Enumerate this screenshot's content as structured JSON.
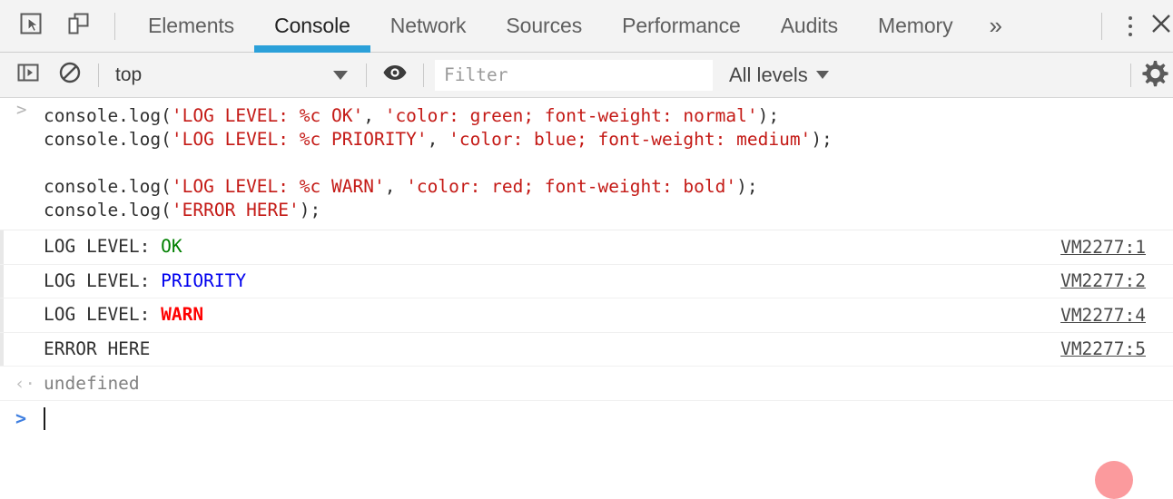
{
  "window": {
    "title": "DevTools - Console"
  },
  "tabbar": {
    "inspect_icon": "inspect-element-cursor-icon",
    "device_icon": "toggle-device-toolbar-icon",
    "tabs": [
      {
        "id": "elements",
        "label": "Elements",
        "active": false
      },
      {
        "id": "console",
        "label": "Console",
        "active": true
      },
      {
        "id": "network",
        "label": "Network",
        "active": false
      },
      {
        "id": "sources",
        "label": "Sources",
        "active": false
      },
      {
        "id": "performance",
        "label": "Performance",
        "active": false
      },
      {
        "id": "audits",
        "label": "Audits",
        "active": false
      },
      {
        "id": "memory",
        "label": "Memory",
        "active": false
      }
    ],
    "more_tabs_label": "»",
    "more_options_icon": "vertical-dots-icon",
    "close_icon": "close-icon",
    "active_tab_underline_color": "#2ba0d9"
  },
  "toolbar": {
    "sidebar_toggle_icon": "show-console-sidebar-icon",
    "clear_console_icon": "clear-console-icon",
    "context": {
      "value": "top",
      "caret_icon": "chevron-down-icon"
    },
    "live_expression_icon": "eye-icon",
    "filter": {
      "placeholder": "Filter",
      "value": ""
    },
    "levels": {
      "value": "All levels",
      "caret_icon": "chevron-down-icon"
    },
    "settings_icon": "gear-icon"
  },
  "console": {
    "prompt_arrow": ">",
    "return_arrow": "‹·",
    "command": {
      "lines": [
        [
          {
            "t": "code",
            "s": "console.log("
          },
          {
            "t": "str",
            "s": "'LOG LEVEL: %c OK'"
          },
          {
            "t": "code",
            "s": ", "
          },
          {
            "t": "str",
            "s": "'color: green; font-weight: normal'"
          },
          {
            "t": "code",
            "s": ");"
          }
        ],
        [
          {
            "t": "code",
            "s": "console.log("
          },
          {
            "t": "str",
            "s": "'LOG LEVEL: %c PRIORITY'"
          },
          {
            "t": "code",
            "s": ", "
          },
          {
            "t": "str",
            "s": "'color: blue; font-weight: medium'"
          },
          {
            "t": "code",
            "s": ");"
          }
        ],
        [],
        [
          {
            "t": "code",
            "s": "console.log("
          },
          {
            "t": "str",
            "s": "'LOG LEVEL: %c WARN'"
          },
          {
            "t": "code",
            "s": ", "
          },
          {
            "t": "str",
            "s": "'color: red; font-weight: bold'"
          },
          {
            "t": "code",
            "s": ");"
          }
        ],
        [
          {
            "t": "code",
            "s": "console.log("
          },
          {
            "t": "str",
            "s": "'ERROR HERE'"
          },
          {
            "t": "code",
            "s": ");"
          }
        ]
      ]
    },
    "logs": [
      {
        "prefix": "LOG LEVEL: ",
        "value": "OK",
        "value_style": "v-ok",
        "value_color": "#008000",
        "value_weight": "normal",
        "source": "VM2277:1"
      },
      {
        "prefix": "LOG LEVEL: ",
        "value": "PRIORITY",
        "value_style": "v-pri",
        "value_color": "#0000ee",
        "value_weight": "normal",
        "source": "VM2277:2"
      },
      {
        "prefix": "LOG LEVEL: ",
        "value": "WARN",
        "value_style": "v-warn",
        "value_color": "#ff0000",
        "value_weight": "bold",
        "source": "VM2277:4"
      },
      {
        "prefix": "ERROR HERE",
        "value": "",
        "value_style": "",
        "value_color": "",
        "value_weight": "normal",
        "source": "VM2277:5"
      }
    ],
    "result": "undefined",
    "input_value": ""
  },
  "decoration": {
    "corner_blob_color": "#fb9a9d"
  }
}
